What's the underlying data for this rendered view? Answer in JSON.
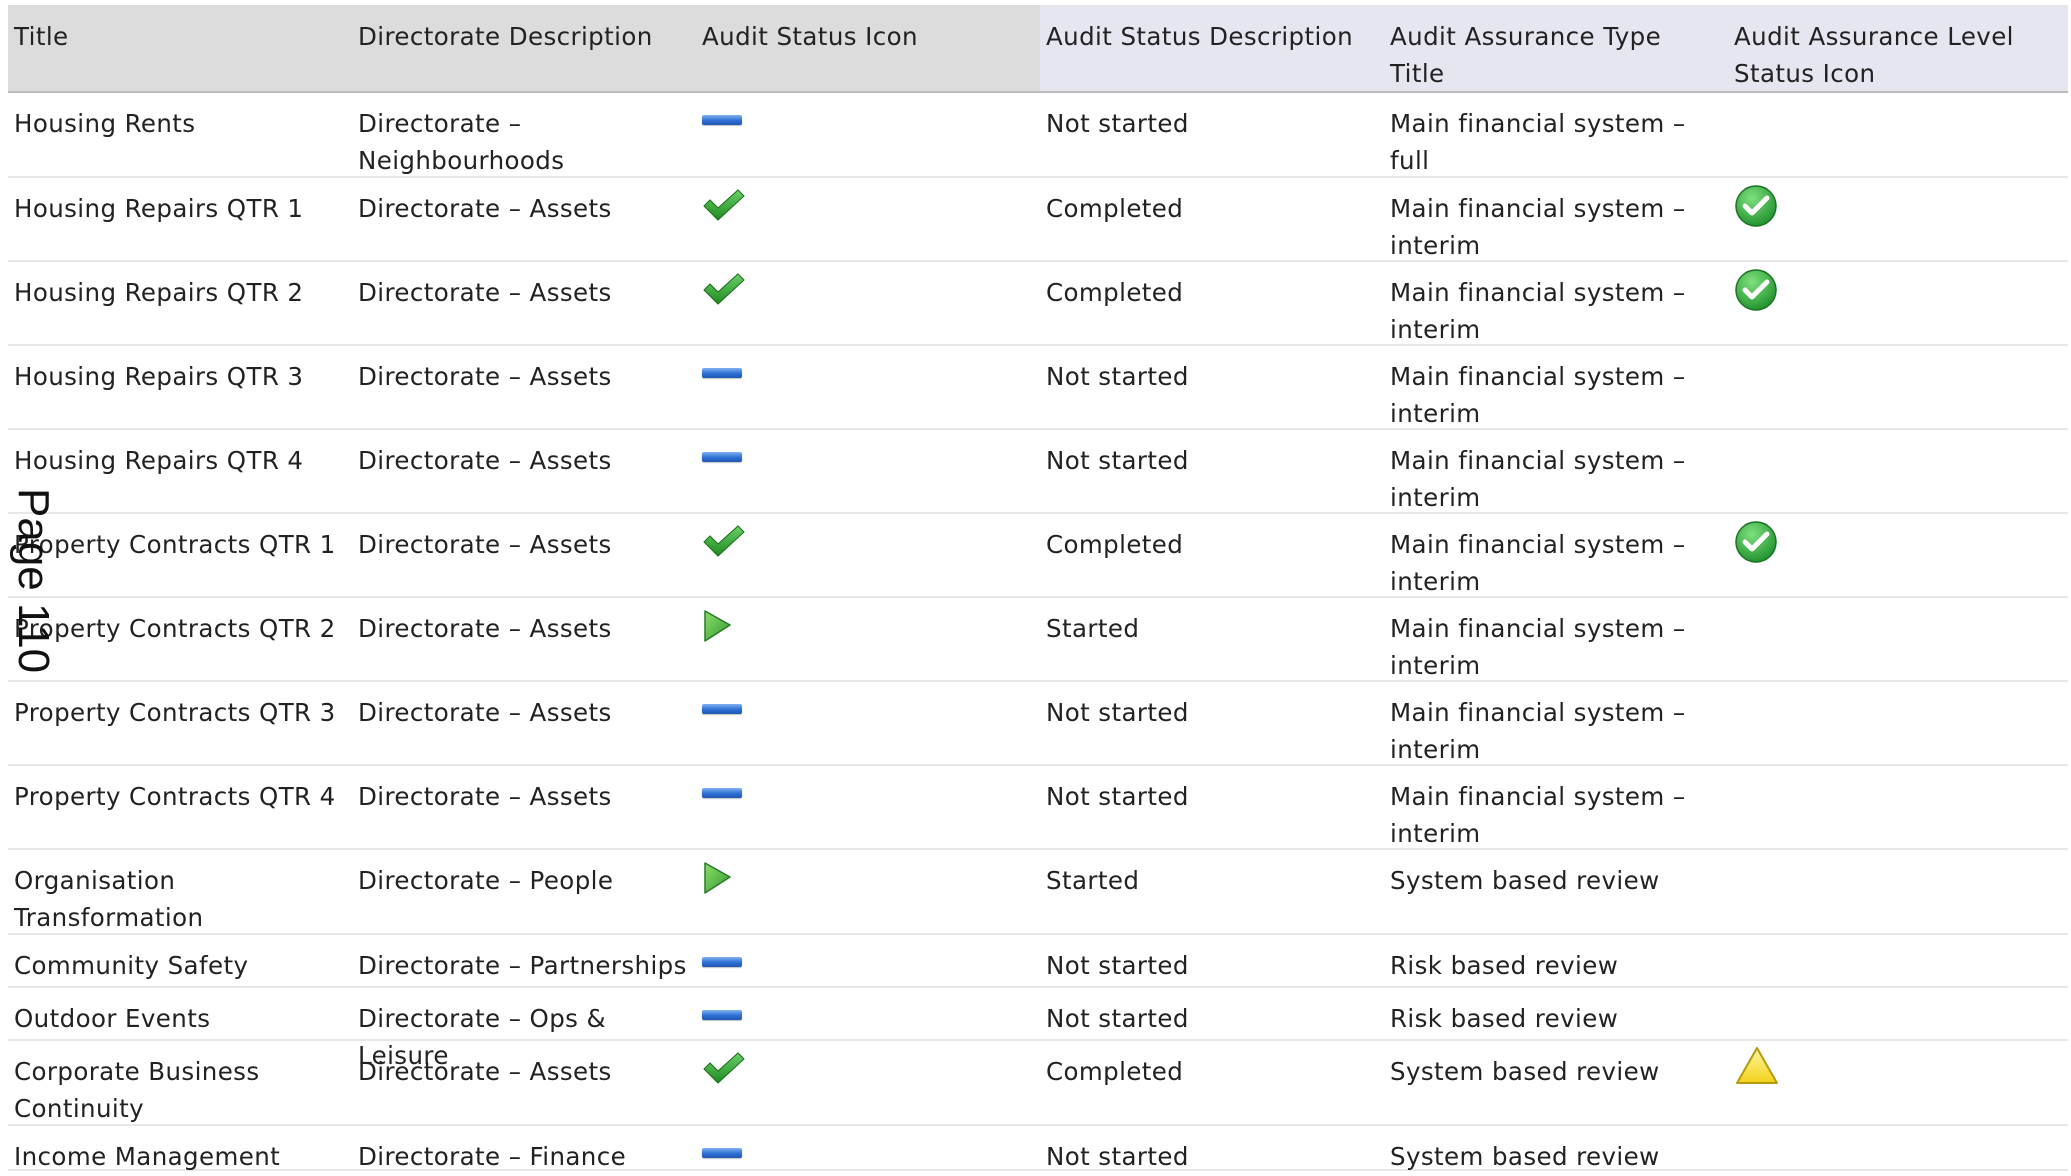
{
  "headers": [
    "Title",
    "Directorate Description",
    "Audit Status Icon",
    "Audit Status Description",
    "Audit Assurance Type Title",
    "Audit Assurance Level Status Icon"
  ],
  "rows": [
    {
      "title": "Housing Rents",
      "directorate": "Directorate – Neighbourhoods",
      "status_icon": "not-started-dash-icon",
      "status": "Not started",
      "assurance_type": "Main financial system – full",
      "level_icon": ""
    },
    {
      "title": "Housing Repairs QTR 1",
      "directorate": "Directorate – Assets",
      "status_icon": "checkmark-icon",
      "status": "Completed",
      "assurance_type": "Main financial system – interim",
      "level_icon": "green-check-circle-icon"
    },
    {
      "title": "Housing Repairs QTR 2",
      "directorate": "Directorate – Assets",
      "status_icon": "checkmark-icon",
      "status": "Completed",
      "assurance_type": "Main financial system – interim",
      "level_icon": "green-check-circle-icon"
    },
    {
      "title": "Housing Repairs QTR 3",
      "directorate": "Directorate – Assets",
      "status_icon": "not-started-dash-icon",
      "status": "Not started",
      "assurance_type": "Main financial system – interim",
      "level_icon": ""
    },
    {
      "title": "Housing Repairs QTR 4",
      "directorate": "Directorate – Assets",
      "status_icon": "not-started-dash-icon",
      "status": "Not started",
      "assurance_type": "Main financial system – interim",
      "level_icon": ""
    },
    {
      "title": "Property Contracts QTR 1",
      "directorate": "Directorate – Assets",
      "status_icon": "checkmark-icon",
      "status": "Completed",
      "assurance_type": "Main financial system – interim",
      "level_icon": "green-check-circle-icon"
    },
    {
      "title": "Property Contracts QTR 2",
      "directorate": "Directorate – Assets",
      "status_icon": "started-play-icon",
      "status": "Started",
      "assurance_type": "Main financial system – interim",
      "level_icon": ""
    },
    {
      "title": "Property Contracts QTR 3",
      "directorate": "Directorate – Assets",
      "status_icon": "not-started-dash-icon",
      "status": "Not started",
      "assurance_type": "Main financial system – interim",
      "level_icon": ""
    },
    {
      "title": "Property Contracts QTR 4",
      "directorate": "Directorate – Assets",
      "status_icon": "not-started-dash-icon",
      "status": "Not started",
      "assurance_type": "Main financial system – interim",
      "level_icon": ""
    },
    {
      "title": "Organisation Transformation",
      "directorate": "Directorate – People",
      "status_icon": "started-play-icon",
      "status": "Started",
      "assurance_type": "System based review",
      "level_icon": ""
    },
    {
      "title": "Community Safety",
      "directorate": "Directorate – Partnerships",
      "status_icon": "not-started-dash-icon",
      "status": "Not started",
      "assurance_type": "Risk based review",
      "level_icon": ""
    },
    {
      "title": "Outdoor Events",
      "directorate": "Directorate – Ops & Leisure",
      "status_icon": "not-started-dash-icon",
      "status": "Not started",
      "assurance_type": "Risk based review",
      "level_icon": ""
    },
    {
      "title": "Corporate Business Continuity",
      "directorate": "Directorate – Assets",
      "status_icon": "checkmark-icon",
      "status": "Completed",
      "assurance_type": "System based review",
      "level_icon": "yellow-warning-triangle-icon"
    },
    {
      "title": "Income Management",
      "directorate": "Directorate – Finance",
      "status_icon": "not-started-dash-icon",
      "status": "Not started",
      "assurance_type": "System based review",
      "level_icon": ""
    }
  ],
  "page_label": "Page 110"
}
